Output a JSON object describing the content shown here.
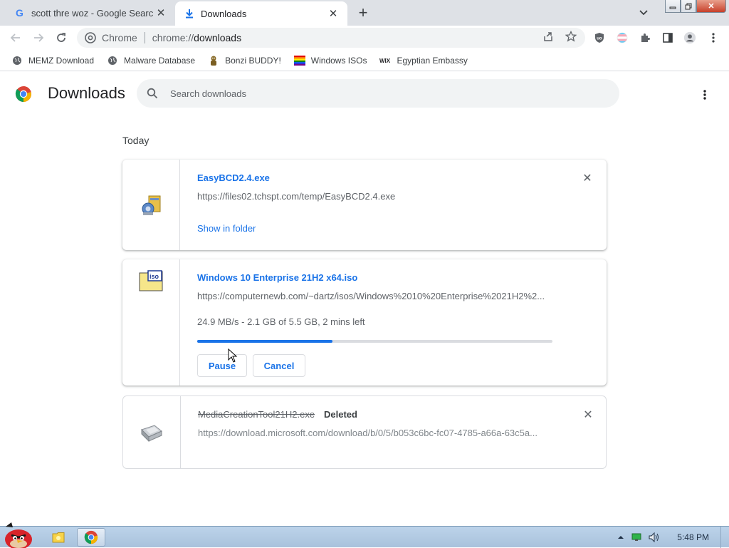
{
  "tabs": [
    {
      "title": "scott thre woz - Google Search"
    },
    {
      "title": "Downloads"
    }
  ],
  "toolbar": {
    "site_chip": "Chrome",
    "url_scheme": "chrome://",
    "url_path": "downloads"
  },
  "bookmarks": [
    {
      "label": "MEMZ Download"
    },
    {
      "label": "Malware Database"
    },
    {
      "label": "Bonzi BUDDY!"
    },
    {
      "label": "Windows ISOs"
    },
    {
      "label": "Egyptian Embassy"
    }
  ],
  "page": {
    "title": "Downloads",
    "search_placeholder": "Search downloads",
    "section": "Today"
  },
  "downloads": [
    {
      "filename": "EasyBCD2.4.exe",
      "url": "https://files02.tchspt.com/temp/EasyBCD2.4.exe",
      "action": "Show in folder"
    },
    {
      "filename": "Windows 10 Enterprise 21H2 x64.iso",
      "url": "https://computernewb.com/~dartz/isos/Windows%2010%20Enterprise%2021H2%2...",
      "status": "24.9 MB/s - 2.1 GB of 5.5 GB, 2 mins left",
      "progress": 0.38,
      "pause_label": "Pause",
      "cancel_label": "Cancel"
    },
    {
      "filename": "MediaCreationTool21H2.exe",
      "tag": "Deleted",
      "url": "https://download.microsoft.com/download/b/0/5/b053c6bc-fc07-4785-a66a-63c5a..."
    }
  ],
  "taskbar": {
    "clock": "5:48 PM"
  },
  "colors": {
    "accent": "#1a73e8",
    "tabstrip": "#dee1e6"
  }
}
